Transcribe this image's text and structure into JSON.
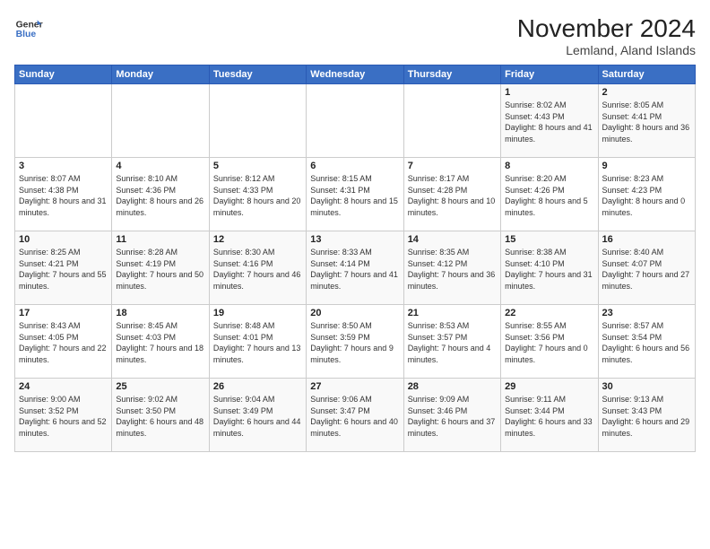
{
  "logo": {
    "line1": "General",
    "line2": "Blue"
  },
  "title": "November 2024",
  "subtitle": "Lemland, Aland Islands",
  "headers": [
    "Sunday",
    "Monday",
    "Tuesday",
    "Wednesday",
    "Thursday",
    "Friday",
    "Saturday"
  ],
  "weeks": [
    [
      {
        "day": "",
        "info": ""
      },
      {
        "day": "",
        "info": ""
      },
      {
        "day": "",
        "info": ""
      },
      {
        "day": "",
        "info": ""
      },
      {
        "day": "",
        "info": ""
      },
      {
        "day": "1",
        "info": "Sunrise: 8:02 AM\nSunset: 4:43 PM\nDaylight: 8 hours and 41 minutes."
      },
      {
        "day": "2",
        "info": "Sunrise: 8:05 AM\nSunset: 4:41 PM\nDaylight: 8 hours and 36 minutes."
      }
    ],
    [
      {
        "day": "3",
        "info": "Sunrise: 8:07 AM\nSunset: 4:38 PM\nDaylight: 8 hours and 31 minutes."
      },
      {
        "day": "4",
        "info": "Sunrise: 8:10 AM\nSunset: 4:36 PM\nDaylight: 8 hours and 26 minutes."
      },
      {
        "day": "5",
        "info": "Sunrise: 8:12 AM\nSunset: 4:33 PM\nDaylight: 8 hours and 20 minutes."
      },
      {
        "day": "6",
        "info": "Sunrise: 8:15 AM\nSunset: 4:31 PM\nDaylight: 8 hours and 15 minutes."
      },
      {
        "day": "7",
        "info": "Sunrise: 8:17 AM\nSunset: 4:28 PM\nDaylight: 8 hours and 10 minutes."
      },
      {
        "day": "8",
        "info": "Sunrise: 8:20 AM\nSunset: 4:26 PM\nDaylight: 8 hours and 5 minutes."
      },
      {
        "day": "9",
        "info": "Sunrise: 8:23 AM\nSunset: 4:23 PM\nDaylight: 8 hours and 0 minutes."
      }
    ],
    [
      {
        "day": "10",
        "info": "Sunrise: 8:25 AM\nSunset: 4:21 PM\nDaylight: 7 hours and 55 minutes."
      },
      {
        "day": "11",
        "info": "Sunrise: 8:28 AM\nSunset: 4:19 PM\nDaylight: 7 hours and 50 minutes."
      },
      {
        "day": "12",
        "info": "Sunrise: 8:30 AM\nSunset: 4:16 PM\nDaylight: 7 hours and 46 minutes."
      },
      {
        "day": "13",
        "info": "Sunrise: 8:33 AM\nSunset: 4:14 PM\nDaylight: 7 hours and 41 minutes."
      },
      {
        "day": "14",
        "info": "Sunrise: 8:35 AM\nSunset: 4:12 PM\nDaylight: 7 hours and 36 minutes."
      },
      {
        "day": "15",
        "info": "Sunrise: 8:38 AM\nSunset: 4:10 PM\nDaylight: 7 hours and 31 minutes."
      },
      {
        "day": "16",
        "info": "Sunrise: 8:40 AM\nSunset: 4:07 PM\nDaylight: 7 hours and 27 minutes."
      }
    ],
    [
      {
        "day": "17",
        "info": "Sunrise: 8:43 AM\nSunset: 4:05 PM\nDaylight: 7 hours and 22 minutes."
      },
      {
        "day": "18",
        "info": "Sunrise: 8:45 AM\nSunset: 4:03 PM\nDaylight: 7 hours and 18 minutes."
      },
      {
        "day": "19",
        "info": "Sunrise: 8:48 AM\nSunset: 4:01 PM\nDaylight: 7 hours and 13 minutes."
      },
      {
        "day": "20",
        "info": "Sunrise: 8:50 AM\nSunset: 3:59 PM\nDaylight: 7 hours and 9 minutes."
      },
      {
        "day": "21",
        "info": "Sunrise: 8:53 AM\nSunset: 3:57 PM\nDaylight: 7 hours and 4 minutes."
      },
      {
        "day": "22",
        "info": "Sunrise: 8:55 AM\nSunset: 3:56 PM\nDaylight: 7 hours and 0 minutes."
      },
      {
        "day": "23",
        "info": "Sunrise: 8:57 AM\nSunset: 3:54 PM\nDaylight: 6 hours and 56 minutes."
      }
    ],
    [
      {
        "day": "24",
        "info": "Sunrise: 9:00 AM\nSunset: 3:52 PM\nDaylight: 6 hours and 52 minutes."
      },
      {
        "day": "25",
        "info": "Sunrise: 9:02 AM\nSunset: 3:50 PM\nDaylight: 6 hours and 48 minutes."
      },
      {
        "day": "26",
        "info": "Sunrise: 9:04 AM\nSunset: 3:49 PM\nDaylight: 6 hours and 44 minutes."
      },
      {
        "day": "27",
        "info": "Sunrise: 9:06 AM\nSunset: 3:47 PM\nDaylight: 6 hours and 40 minutes."
      },
      {
        "day": "28",
        "info": "Sunrise: 9:09 AM\nSunset: 3:46 PM\nDaylight: 6 hours and 37 minutes."
      },
      {
        "day": "29",
        "info": "Sunrise: 9:11 AM\nSunset: 3:44 PM\nDaylight: 6 hours and 33 minutes."
      },
      {
        "day": "30",
        "info": "Sunrise: 9:13 AM\nSunset: 3:43 PM\nDaylight: 6 hours and 29 minutes."
      }
    ]
  ]
}
